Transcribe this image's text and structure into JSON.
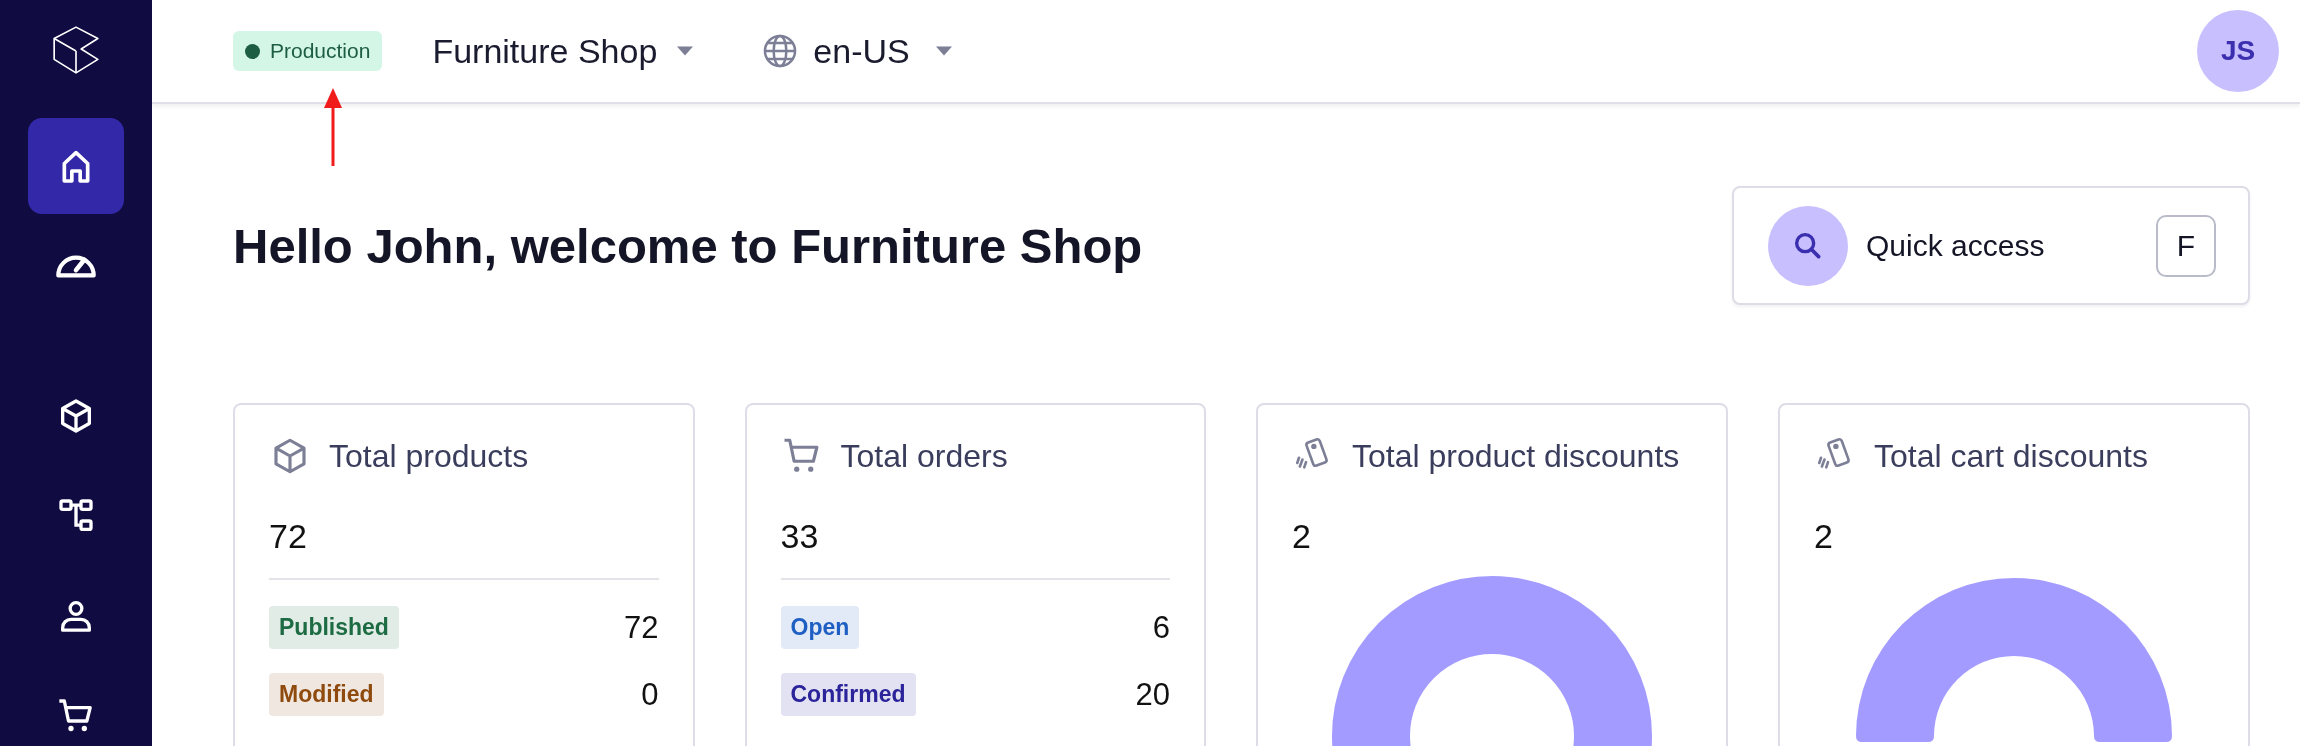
{
  "sidebar": {
    "items": [
      {
        "kind": "home",
        "selected": true
      },
      {
        "kind": "gauge",
        "selected": false
      },
      {
        "kind": "cube",
        "selected": false
      },
      {
        "kind": "tree",
        "selected": false
      },
      {
        "kind": "person",
        "selected": false
      },
      {
        "kind": "cart",
        "selected": false
      }
    ]
  },
  "topbar": {
    "environment": {
      "label": "Production",
      "color": "#1d5d44"
    },
    "project": {
      "label": "Furniture Shop"
    },
    "locale": {
      "label": "en-US"
    },
    "avatar": {
      "initials": "JS"
    }
  },
  "heading": "Hello John, welcome to Furniture Shop",
  "quick_access": {
    "label": "Quick access",
    "shortcut": "F"
  },
  "cards": [
    {
      "kind": "products",
      "title": "Total products",
      "total": "72",
      "rows": [
        {
          "label": "Published",
          "value": "72",
          "color": "#1d6b42"
        },
        {
          "label": "Modified",
          "value": "0",
          "color": "#8f4a0e"
        }
      ]
    },
    {
      "kind": "orders",
      "title": "Total orders",
      "total": "33",
      "rows": [
        {
          "label": "Open",
          "value": "6",
          "color": "#1f5fc4"
        },
        {
          "label": "Confirmed",
          "value": "20",
          "color": "#2b2399"
        }
      ]
    },
    {
      "kind": "product_discounts",
      "title": "Total product discounts",
      "total": "2"
    },
    {
      "kind": "cart_discounts",
      "title": "Total cart discounts",
      "total": "2"
    }
  ]
}
